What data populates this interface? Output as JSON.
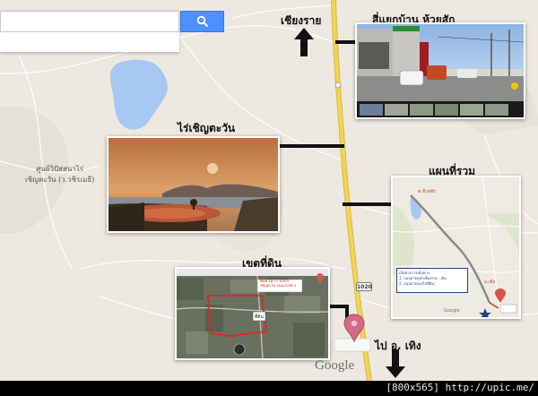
{
  "search": {
    "placeholder": "",
    "button_icon": "search-icon",
    "button_color": "#4d90fe"
  },
  "labels": {
    "chiang_rai": "เชียงราย",
    "intersection": "สี่แยกบ้าน ห้วยสัก",
    "farm": "ไร่เชิญตะวัน",
    "map_overview": "แผนที่รวม",
    "land_area": "เขตที่ดิน",
    "to_thoeng": "ไป อ. เทิง"
  },
  "map_text": {
    "center_line1": "ศูนย์วิปัสสนาไร่",
    "center_line2": "เชิญตะวัน (ว.วชิรเมธี)",
    "route_number": "1020",
    "google_logo": "Google"
  },
  "inset_map": {
    "place_top": "ต.ห้วยสัก",
    "place_right": "อ.เทิง",
    "google": "Google",
    "legend_line1": "เส้นทางการเดินทาง",
    "legend_line2": "1. ถนนสายหลักเชียงราย - เทิง",
    "legend_line3": "2. ถนนสายรองไปที่ดิน"
  },
  "land_map": {
    "popup_line1": "พื้นที่ 18 ไร่ ใกล้ไร่",
    "popup_line2": "เชิญตะวัน ถนนลาดยาง",
    "plot_label": "ที่ดิน"
  },
  "footer": {
    "text": "[800x565] http://upic.me/"
  },
  "colors": {
    "map_background": "#ede9e1",
    "highway": "#f2d35b",
    "water": "#a6c8f2",
    "pin": "#d46a87"
  }
}
